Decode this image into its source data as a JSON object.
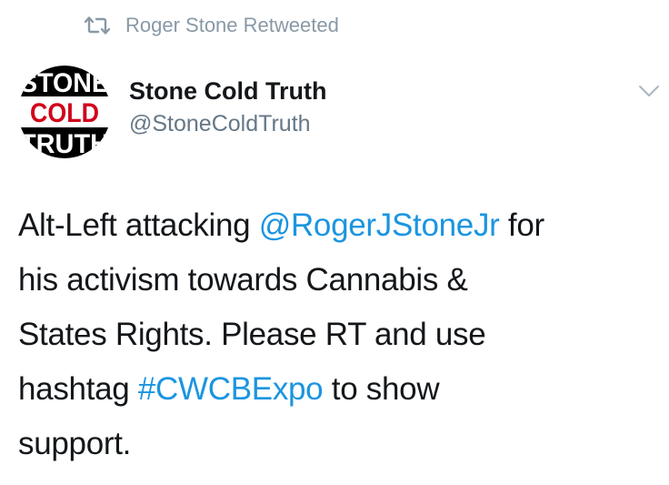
{
  "retweet": {
    "icon": "retweet-icon",
    "text": "Roger Stone Retweeted"
  },
  "author": {
    "avatar": {
      "icon": "stone-cold-truth-logo",
      "lines": [
        "STONE",
        "COLD",
        "TRUTH"
      ]
    },
    "name": "Stone Cold Truth",
    "handle": "@StoneColdTruth"
  },
  "menu": {
    "icon": "chevron-down-icon"
  },
  "tweet": {
    "line1_a": "Alt-Left attacking ",
    "mention": "@RogerJStoneJr",
    "line1_b": " for",
    "line2": "his activism towards Cannabis &",
    "line3": "States Rights. Please RT and use",
    "line4_a": "hashtag ",
    "hashtag": "#CWCBExpo",
    "line4_b": " to show",
    "line5": "support."
  },
  "colors": {
    "link": "#1b95e0",
    "muted": "#8899a6",
    "text": "#14171a",
    "logo_red": "#d0021b"
  }
}
